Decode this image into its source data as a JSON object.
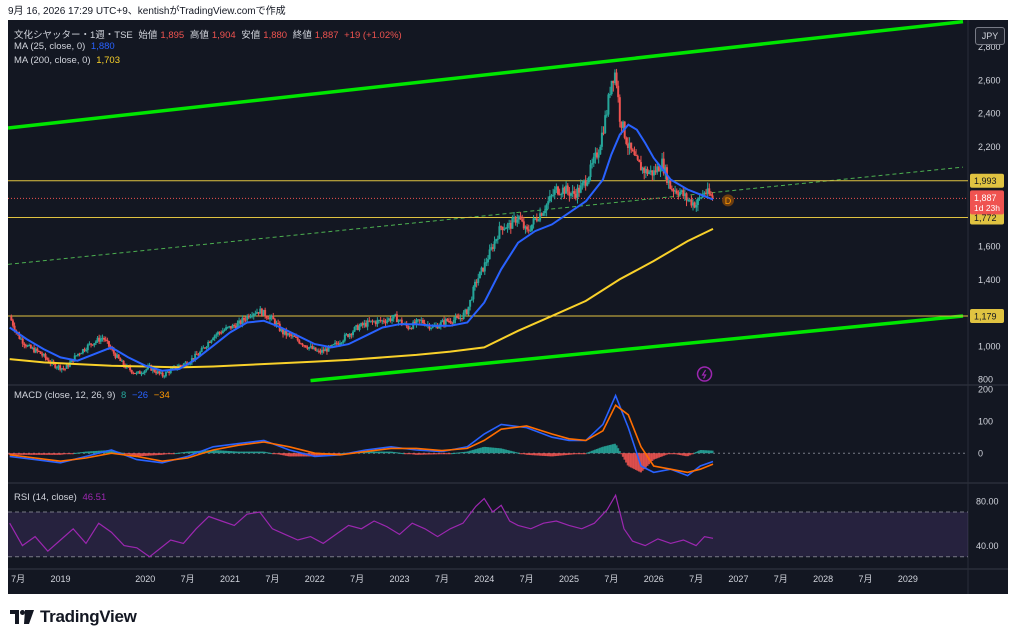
{
  "topline": "9月 16, 2026 17:29 UTC+9、kentishがTradingView.comで作成",
  "legend": {
    "symbol": "文化シヤッター・1週・TSE",
    "open_label": "始値",
    "open": "1,895",
    "high_label": "高値",
    "high": "1,904",
    "low_label": "安値",
    "low": "1,880",
    "close_label": "終値",
    "close": "1,887",
    "change": "+19 (+1.02%)",
    "ma25_label": "MA (25, close, 0)",
    "ma25_value": "1,880",
    "ma200_label": "MA (200, close, 0)",
    "ma200_value": "1,703"
  },
  "currency_button": "JPY",
  "macd_legend": {
    "label": "MACD (close, 12, 26, 9)",
    "hist": "8",
    "macd": "−26",
    "signal": "−34"
  },
  "rsi_legend": {
    "label": "RSI (14, close)",
    "value": "46.51"
  },
  "price_labels": {
    "resistance": "1,993",
    "current": "1,887",
    "countdown": "1d 23h",
    "support": "1,772",
    "lower": "1,179"
  },
  "marker_d": "D",
  "footer_brand": "TradingView",
  "colors": {
    "up": "#26a69a",
    "down": "#ef5350",
    "ma25": "#2962ff",
    "ma200": "#f9d12a",
    "trend": "#00e600",
    "hline": "#e0c341",
    "rsi": "#9c27b0",
    "macd_line": "#2962ff",
    "signal_line": "#ff6d00"
  },
  "chart_data": {
    "type": "line",
    "title": "文化シヤッター・1週・TSE",
    "price_axis": {
      "ticks": [
        800,
        1000,
        1200,
        1400,
        1600,
        1800,
        2000,
        2200,
        2400,
        2600,
        2800
      ],
      "tick_labels": [
        "800",
        "1,000",
        "",
        "1,400",
        "1,600",
        "",
        "",
        "2,200",
        "2,400",
        "2,600",
        "2,800"
      ],
      "ylim": [
        770,
        2960
      ]
    },
    "time_axis": {
      "ticks": [
        "7月",
        "2019",
        "2020",
        "7月",
        "2021",
        "7月",
        "2022",
        "7月",
        "2023",
        "7月",
        "2024",
        "7月",
        "2025",
        "7月",
        "2026",
        "7月",
        "2027",
        "7月",
        "2028",
        "7月",
        "2029"
      ],
      "positions": [
        2018.5,
        2019,
        2020,
        2020.5,
        2021,
        2021.5,
        2022,
        2022.5,
        2023,
        2023.5,
        2024,
        2024.5,
        2025,
        2025.5,
        2026,
        2026.5,
        2027,
        2027.5,
        2028,
        2028.5,
        2029
      ],
      "xlim": [
        2018.38,
        2029.65
      ]
    },
    "price": [
      [
        2018.4,
        1175
      ],
      [
        2018.5,
        1060
      ],
      [
        2018.62,
        990
      ],
      [
        2018.75,
        960
      ],
      [
        2018.9,
        890
      ],
      [
        2019.05,
        860
      ],
      [
        2019.2,
        950
      ],
      [
        2019.35,
        1010
      ],
      [
        2019.5,
        1050
      ],
      [
        2019.62,
        960
      ],
      [
        2019.75,
        880
      ],
      [
        2019.9,
        830
      ],
      [
        2020.05,
        870
      ],
      [
        2020.2,
        820
      ],
      [
        2020.35,
        870
      ],
      [
        2020.5,
        900
      ],
      [
        2020.65,
        960
      ],
      [
        2020.8,
        1060
      ],
      [
        2020.95,
        1100
      ],
      [
        2021.1,
        1130
      ],
      [
        2021.25,
        1200
      ],
      [
        2021.35,
        1210
      ],
      [
        2021.5,
        1160
      ],
      [
        2021.62,
        1080
      ],
      [
        2021.75,
        1050
      ],
      [
        2021.9,
        1000
      ],
      [
        2022.05,
        960
      ],
      [
        2022.2,
        990
      ],
      [
        2022.35,
        1050
      ],
      [
        2022.5,
        1110
      ],
      [
        2022.65,
        1140
      ],
      [
        2022.8,
        1150
      ],
      [
        2022.95,
        1170
      ],
      [
        2023.1,
        1110
      ],
      [
        2023.25,
        1150
      ],
      [
        2023.4,
        1110
      ],
      [
        2023.55,
        1150
      ],
      [
        2023.7,
        1160
      ],
      [
        2023.8,
        1210
      ],
      [
        2023.9,
        1380
      ],
      [
        2024.0,
        1480
      ],
      [
        2024.1,
        1600
      ],
      [
        2024.2,
        1720
      ],
      [
        2024.3,
        1720
      ],
      [
        2024.4,
        1780
      ],
      [
        2024.5,
        1680
      ],
      [
        2024.6,
        1760
      ],
      [
        2024.7,
        1820
      ],
      [
        2024.85,
        1940
      ],
      [
        2024.95,
        1940
      ],
      [
        2025.05,
        1910
      ],
      [
        2025.15,
        1950
      ],
      [
        2025.25,
        2050
      ],
      [
        2025.35,
        2180
      ],
      [
        2025.45,
        2420
      ],
      [
        2025.5,
        2600
      ],
      [
        2025.55,
        2650
      ],
      [
        2025.6,
        2380
      ],
      [
        2025.7,
        2200
      ],
      [
        2025.8,
        2100
      ],
      [
        2025.9,
        2050
      ],
      [
        2026.0,
        2040
      ],
      [
        2026.1,
        2100
      ],
      [
        2026.2,
        1950
      ],
      [
        2026.3,
        1930
      ],
      [
        2026.4,
        1880
      ],
      [
        2026.5,
        1850
      ],
      [
        2026.6,
        1930
      ],
      [
        2026.7,
        1887
      ]
    ],
    "ma25": [
      [
        2018.4,
        1110
      ],
      [
        2018.6,
        1040
      ],
      [
        2018.8,
        980
      ],
      [
        2019.0,
        930
      ],
      [
        2019.2,
        910
      ],
      [
        2019.4,
        950
      ],
      [
        2019.6,
        990
      ],
      [
        2019.8,
        930
      ],
      [
        2020.0,
        880
      ],
      [
        2020.2,
        850
      ],
      [
        2020.4,
        860
      ],
      [
        2020.6,
        920
      ],
      [
        2020.8,
        1000
      ],
      [
        2021.0,
        1080
      ],
      [
        2021.2,
        1140
      ],
      [
        2021.4,
        1150
      ],
      [
        2021.6,
        1110
      ],
      [
        2021.8,
        1060
      ],
      [
        2022.0,
        1010
      ],
      [
        2022.2,
        990
      ],
      [
        2022.4,
        1010
      ],
      [
        2022.6,
        1060
      ],
      [
        2022.8,
        1110
      ],
      [
        2023.0,
        1130
      ],
      [
        2023.2,
        1130
      ],
      [
        2023.4,
        1120
      ],
      [
        2023.6,
        1120
      ],
      [
        2023.8,
        1140
      ],
      [
        2024.0,
        1260
      ],
      [
        2024.2,
        1460
      ],
      [
        2024.4,
        1620
      ],
      [
        2024.6,
        1690
      ],
      [
        2024.8,
        1730
      ],
      [
        2025.0,
        1800
      ],
      [
        2025.2,
        1870
      ],
      [
        2025.4,
        2000
      ],
      [
        2025.5,
        2150
      ],
      [
        2025.6,
        2270
      ],
      [
        2025.7,
        2330
      ],
      [
        2025.8,
        2300
      ],
      [
        2025.9,
        2220
      ],
      [
        2026.0,
        2130
      ],
      [
        2026.2,
        2000
      ],
      [
        2026.4,
        1940
      ],
      [
        2026.6,
        1900
      ],
      [
        2026.7,
        1880
      ]
    ],
    "ma200": [
      [
        2018.4,
        920
      ],
      [
        2018.8,
        900
      ],
      [
        2019.2,
        890
      ],
      [
        2019.6,
        880
      ],
      [
        2020.0,
        875
      ],
      [
        2020.4,
        870
      ],
      [
        2020.8,
        875
      ],
      [
        2021.2,
        885
      ],
      [
        2021.6,
        895
      ],
      [
        2022.0,
        905
      ],
      [
        2022.4,
        915
      ],
      [
        2022.8,
        930
      ],
      [
        2023.2,
        945
      ],
      [
        2023.6,
        965
      ],
      [
        2024.0,
        990
      ],
      [
        2024.4,
        1090
      ],
      [
        2024.8,
        1180
      ],
      [
        2025.2,
        1270
      ],
      [
        2025.6,
        1400
      ],
      [
        2026.0,
        1510
      ],
      [
        2026.4,
        1630
      ],
      [
        2026.7,
        1703
      ]
    ],
    "horizontal_levels": [
      1993,
      1887,
      1772,
      1179
    ],
    "trendlines": [
      {
        "name": "upper-channel",
        "from": [
          2018.38,
          2310
        ],
        "to": [
          2029.65,
          2950
        ]
      },
      {
        "name": "lower-channel",
        "from": [
          2021.95,
          790
        ],
        "to": [
          2029.65,
          1179
        ]
      },
      {
        "name": "dashed-trend",
        "from": [
          2018.38,
          1490
        ],
        "to": [
          2029.65,
          2075
        ]
      }
    ],
    "macd_axis": {
      "ticks": [
        200,
        100,
        0
      ],
      "tick_labels": [
        "200",
        "100",
        "0"
      ],
      "ylim": [
        -90,
        210
      ]
    },
    "macd": [
      [
        2018.4,
        -10
      ],
      [
        2018.7,
        -20
      ],
      [
        2019.0,
        -30
      ],
      [
        2019.3,
        -10
      ],
      [
        2019.6,
        10
      ],
      [
        2019.9,
        -20
      ],
      [
        2020.2,
        -30
      ],
      [
        2020.5,
        -10
      ],
      [
        2020.8,
        20
      ],
      [
        2021.1,
        30
      ],
      [
        2021.4,
        40
      ],
      [
        2021.7,
        10
      ],
      [
        2022.0,
        -10
      ],
      [
        2022.3,
        -5
      ],
      [
        2022.6,
        10
      ],
      [
        2022.9,
        20
      ],
      [
        2023.2,
        10
      ],
      [
        2023.5,
        5
      ],
      [
        2023.8,
        20
      ],
      [
        2024.0,
        60
      ],
      [
        2024.2,
        90
      ],
      [
        2024.5,
        80
      ],
      [
        2024.8,
        50
      ],
      [
        2025.0,
        40
      ],
      [
        2025.2,
        40
      ],
      [
        2025.4,
        90
      ],
      [
        2025.55,
        180
      ],
      [
        2025.7,
        80
      ],
      [
        2025.85,
        -40
      ],
      [
        2026.0,
        -60
      ],
      [
        2026.2,
        -50
      ],
      [
        2026.4,
        -70
      ],
      [
        2026.55,
        -40
      ],
      [
        2026.7,
        -26
      ]
    ],
    "signal": [
      [
        2018.4,
        -5
      ],
      [
        2018.7,
        -15
      ],
      [
        2019.0,
        -25
      ],
      [
        2019.3,
        -15
      ],
      [
        2019.6,
        0
      ],
      [
        2019.9,
        -10
      ],
      [
        2020.2,
        -25
      ],
      [
        2020.5,
        -15
      ],
      [
        2020.8,
        10
      ],
      [
        2021.1,
        25
      ],
      [
        2021.4,
        35
      ],
      [
        2021.7,
        20
      ],
      [
        2022.0,
        0
      ],
      [
        2022.3,
        -5
      ],
      [
        2022.6,
        5
      ],
      [
        2022.9,
        15
      ],
      [
        2023.2,
        15
      ],
      [
        2023.5,
        8
      ],
      [
        2023.8,
        15
      ],
      [
        2024.0,
        40
      ],
      [
        2024.2,
        75
      ],
      [
        2024.5,
        85
      ],
      [
        2024.8,
        60
      ],
      [
        2025.0,
        45
      ],
      [
        2025.2,
        40
      ],
      [
        2025.4,
        70
      ],
      [
        2025.55,
        150
      ],
      [
        2025.7,
        120
      ],
      [
        2025.85,
        20
      ],
      [
        2026.0,
        -40
      ],
      [
        2026.2,
        -50
      ],
      [
        2026.4,
        -60
      ],
      [
        2026.55,
        -50
      ],
      [
        2026.7,
        -34
      ]
    ],
    "rsi_axis": {
      "ticks": [
        80,
        40
      ],
      "tick_labels": [
        "80.00",
        "40.00"
      ],
      "bands": [
        70,
        30
      ],
      "ylim": [
        20,
        95
      ]
    },
    "rsi": [
      [
        2018.4,
        60
      ],
      [
        2018.55,
        40
      ],
      [
        2018.7,
        48
      ],
      [
        2018.85,
        35
      ],
      [
        2019.0,
        45
      ],
      [
        2019.15,
        55
      ],
      [
        2019.3,
        42
      ],
      [
        2019.45,
        60
      ],
      [
        2019.6,
        52
      ],
      [
        2019.75,
        40
      ],
      [
        2019.9,
        38
      ],
      [
        2020.05,
        30
      ],
      [
        2020.15,
        36
      ],
      [
        2020.3,
        45
      ],
      [
        2020.45,
        42
      ],
      [
        2020.6,
        55
      ],
      [
        2020.75,
        66
      ],
      [
        2020.9,
        62
      ],
      [
        2021.05,
        58
      ],
      [
        2021.2,
        68
      ],
      [
        2021.35,
        70
      ],
      [
        2021.5,
        55
      ],
      [
        2021.65,
        50
      ],
      [
        2021.8,
        45
      ],
      [
        2021.95,
        48
      ],
      [
        2022.1,
        42
      ],
      [
        2022.25,
        50
      ],
      [
        2022.4,
        58
      ],
      [
        2022.55,
        55
      ],
      [
        2022.7,
        62
      ],
      [
        2022.85,
        57
      ],
      [
        2023.0,
        50
      ],
      [
        2023.15,
        60
      ],
      [
        2023.3,
        55
      ],
      [
        2023.45,
        48
      ],
      [
        2023.6,
        55
      ],
      [
        2023.75,
        60
      ],
      [
        2023.9,
        75
      ],
      [
        2024.0,
        82
      ],
      [
        2024.1,
        70
      ],
      [
        2024.2,
        76
      ],
      [
        2024.3,
        62
      ],
      [
        2024.4,
        58
      ],
      [
        2024.55,
        55
      ],
      [
        2024.7,
        60
      ],
      [
        2024.85,
        62
      ],
      [
        2025.0,
        58
      ],
      [
        2025.15,
        55
      ],
      [
        2025.3,
        60
      ],
      [
        2025.45,
        72
      ],
      [
        2025.55,
        85
      ],
      [
        2025.65,
        55
      ],
      [
        2025.75,
        44
      ],
      [
        2025.9,
        40
      ],
      [
        2026.05,
        46
      ],
      [
        2026.2,
        42
      ],
      [
        2026.35,
        45
      ],
      [
        2026.5,
        40
      ],
      [
        2026.6,
        48
      ],
      [
        2026.7,
        46.51
      ]
    ]
  }
}
